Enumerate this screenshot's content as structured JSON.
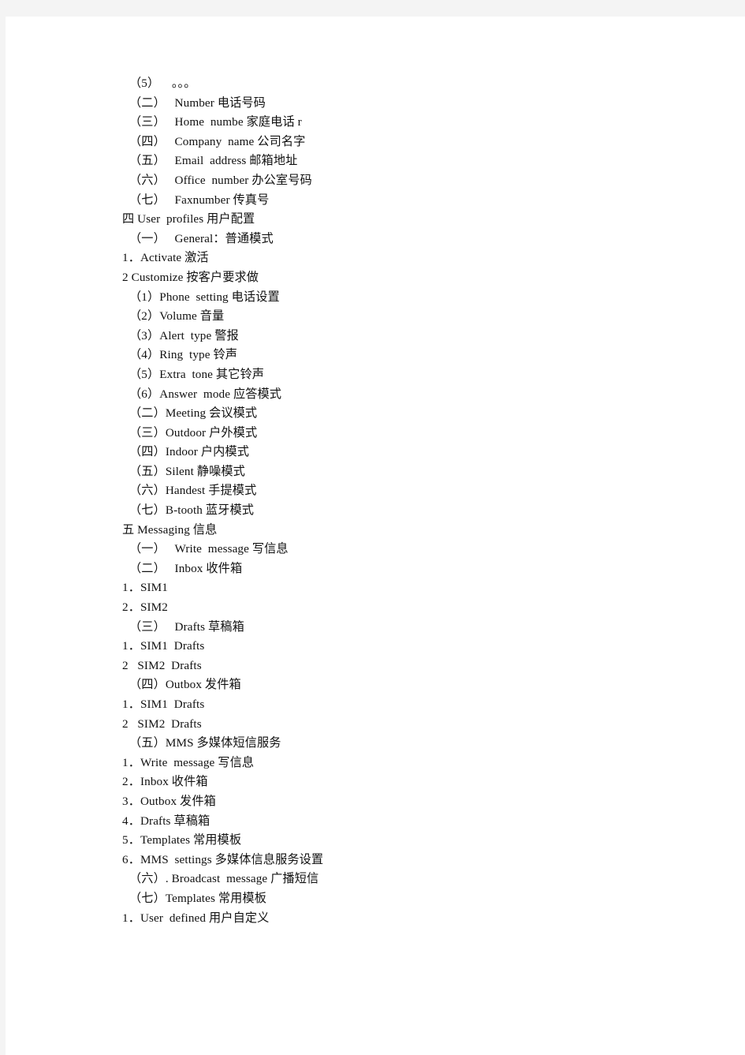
{
  "document": {
    "lines": [
      {
        "text": "（5）    。。。",
        "indent": "paren"
      },
      {
        "text": "（二）   Number 电话号码",
        "indent": "paren"
      },
      {
        "text": "（三）   Home  numbe 家庭电话 r",
        "indent": "paren"
      },
      {
        "text": "（四）   Company  name 公司名字",
        "indent": "paren"
      },
      {
        "text": "（五）   Email  address 邮箱地址",
        "indent": "paren"
      },
      {
        "text": "（六）   Office  number 办公室号码",
        "indent": "paren"
      },
      {
        "text": "（七）   Faxnumber 传真号",
        "indent": "paren"
      },
      {
        "text": "四 User  profiles 用户配置",
        "indent": "sec"
      },
      {
        "text": "（一）   General：普通模式",
        "indent": "paren"
      },
      {
        "text": "1．Activate 激活",
        "indent": "num"
      },
      {
        "text": "2 Customize 按客户要求做",
        "indent": "num"
      },
      {
        "text": "（1）Phone  setting 电话设置",
        "indent": "paren"
      },
      {
        "text": "（2）Volume 音量",
        "indent": "paren"
      },
      {
        "text": "（3）Alert  type 警报",
        "indent": "paren"
      },
      {
        "text": "（4）Ring  type 铃声",
        "indent": "paren"
      },
      {
        "text": "（5）Extra  tone 其它铃声",
        "indent": "paren"
      },
      {
        "text": "（6）Answer  mode 应答模式",
        "indent": "paren"
      },
      {
        "text": "（二）Meeting 会议模式",
        "indent": "paren"
      },
      {
        "text": "（三）Outdoor 户外模式",
        "indent": "paren"
      },
      {
        "text": "（四）Indoor 户内模式",
        "indent": "paren"
      },
      {
        "text": "（五）Silent 静噪模式",
        "indent": "paren"
      },
      {
        "text": "（六）Handest 手提模式",
        "indent": "paren"
      },
      {
        "text": "（七）B-tooth 蓝牙模式",
        "indent": "paren"
      },
      {
        "text": "五 Messaging 信息",
        "indent": "sec"
      },
      {
        "text": "（一）   Write  message 写信息",
        "indent": "paren"
      },
      {
        "text": "（二）   Inbox 收件箱",
        "indent": "paren"
      },
      {
        "text": "1．SIM1",
        "indent": "num"
      },
      {
        "text": "2．SIM2",
        "indent": "num"
      },
      {
        "text": "（三）   Drafts 草稿箱",
        "indent": "paren"
      },
      {
        "text": "1．SIM1  Drafts",
        "indent": "num"
      },
      {
        "text": "2   SIM2  Drafts",
        "indent": "num"
      },
      {
        "text": "（四）Outbox 发件箱",
        "indent": "paren"
      },
      {
        "text": "1．SIM1  Drafts",
        "indent": "num"
      },
      {
        "text": "2   SIM2  Drafts",
        "indent": "num"
      },
      {
        "text": "（五）MMS 多媒体短信服务",
        "indent": "paren"
      },
      {
        "text": "1．Write  message 写信息",
        "indent": "num"
      },
      {
        "text": "2．Inbox 收件箱",
        "indent": "num"
      },
      {
        "text": "3．Outbox 发件箱",
        "indent": "num"
      },
      {
        "text": "4．Drafts 草稿箱",
        "indent": "num"
      },
      {
        "text": "5．Templates 常用模板",
        "indent": "num"
      },
      {
        "text": "6．MMS  settings 多媒体信息服务设置",
        "indent": "num"
      },
      {
        "text": "（六）. Broadcast  message 广播短信",
        "indent": "paren"
      },
      {
        "text": "（七）Templates 常用模板",
        "indent": "paren"
      },
      {
        "text": "1．User  defined 用户自定义",
        "indent": "num"
      }
    ]
  },
  "colors": {
    "page_background": "#ffffff",
    "canvas_background": "#f4f4f4",
    "text": "#111111"
  }
}
